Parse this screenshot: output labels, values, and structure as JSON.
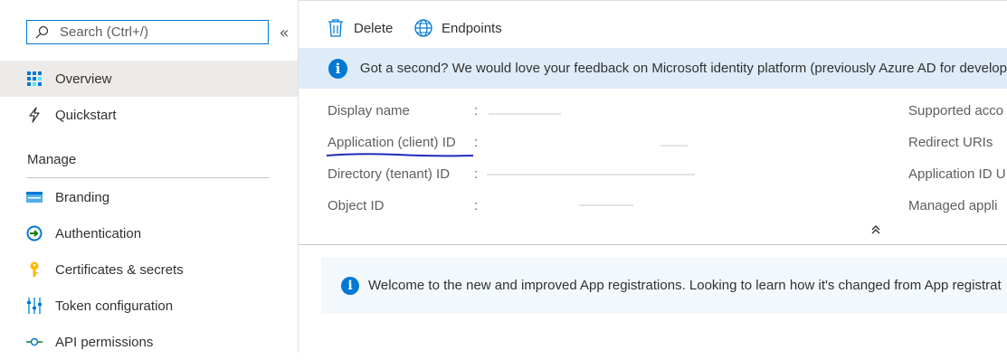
{
  "sidebar": {
    "search_placeholder": "Search (Ctrl+/)",
    "collapse_glyph": "«",
    "overview_label": "Overview",
    "quickstart_label": "Quickstart",
    "manage_title": "Manage",
    "items": [
      {
        "label": "Branding",
        "icon": "branding-icon"
      },
      {
        "label": "Authentication",
        "icon": "authentication-icon"
      },
      {
        "label": "Certificates & secrets",
        "icon": "key-icon"
      },
      {
        "label": "Token configuration",
        "icon": "token-configuration-icon"
      },
      {
        "label": "API permissions",
        "icon": "api-permissions-icon"
      }
    ]
  },
  "toolbar": {
    "delete_label": "Delete",
    "endpoints_label": "Endpoints"
  },
  "feedback": {
    "text": "Got a second? We would love your feedback on Microsoft identity platform (previously Azure AD for develop"
  },
  "essentials": {
    "left": [
      {
        "label": "Display name",
        "separator": ":"
      },
      {
        "label": "Application (client) ID",
        "separator": ":"
      },
      {
        "label": "Directory (tenant) ID",
        "separator": ":"
      },
      {
        "label": "Object ID",
        "separator": ":"
      }
    ],
    "right": [
      {
        "label": "Supported acco"
      },
      {
        "label": "Redirect URIs"
      },
      {
        "label": "Application ID U"
      },
      {
        "label": "Managed appli"
      }
    ],
    "collapse_glyph": "⌃"
  },
  "welcome": {
    "text": "Welcome to the new and improved App registrations. Looking to learn how it's changed from App registrat"
  },
  "colors": {
    "accent": "#0078d4",
    "feedback_bg": "#deecf9",
    "active_nav_bg": "#edebe9"
  }
}
